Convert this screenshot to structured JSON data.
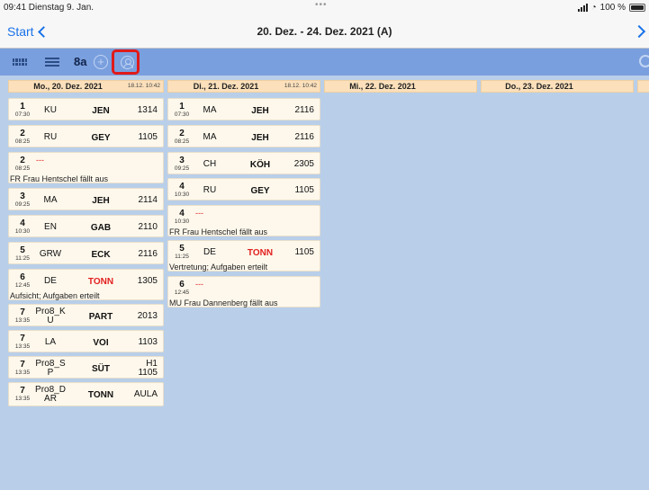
{
  "status": {
    "time_date": "09:41  Dienstag 9. Jan.",
    "dots": "•••",
    "battery": "100 %"
  },
  "nav": {
    "back_label": "Start",
    "title": "20. Dez. - 24. Dez. 2021 (A)"
  },
  "toolbar": {
    "class_label": "8a",
    "add": "+"
  },
  "days": [
    {
      "label": "Mo., 20. Dez. 2021",
      "timestamp": "18.12. 10:42"
    },
    {
      "label": "Di., 21. Dez. 2021",
      "timestamp": "18.12. 10:42"
    },
    {
      "label": "Mi., 22. Dez. 2021",
      "timestamp": ""
    },
    {
      "label": "Do., 23. Dez. 2021",
      "timestamp": ""
    }
  ],
  "monday": [
    {
      "period": "1",
      "time": "07:30",
      "subject": "KU",
      "teacher": "JEN",
      "room": "1314"
    },
    {
      "period": "2",
      "time": "08:25",
      "subject": "RU",
      "teacher": "GEY",
      "room": "1105"
    },
    {
      "period": "2",
      "time": "08:25",
      "dash": "---",
      "note": "FR Frau Hentschel fällt aus"
    },
    {
      "period": "3",
      "time": "09:25",
      "subject": "MA",
      "teacher": "JEH",
      "room": "2114"
    },
    {
      "period": "4",
      "time": "10:30",
      "subject": "EN",
      "teacher": "GAB",
      "room": "2110"
    },
    {
      "period": "5",
      "time": "11:25",
      "subject": "GRW",
      "teacher": "ECK",
      "room": "2116"
    },
    {
      "period": "6",
      "time": "12:45",
      "subject": "DE",
      "teacher": "TONN",
      "room": "1305",
      "note": "Aufsicht; Aufgaben erteilt"
    },
    {
      "period": "7",
      "time": "13:35",
      "subject_line1": "Pro8_K",
      "subject_line2": "U",
      "teacher": "PART",
      "room": "2013"
    },
    {
      "period": "7",
      "time": "13:35",
      "subject": "LA",
      "teacher": "VOI",
      "room": "1103"
    },
    {
      "period": "7",
      "time": "13:35",
      "subject_line1": "Pro8_S",
      "subject_line2": "P",
      "teacher": "SÜT",
      "room_line1": "H1",
      "room_line2": "1105"
    },
    {
      "period": "7",
      "time": "13:35",
      "subject_line1": "Pro8_D",
      "subject_line2": "AR",
      "teacher": "TONN",
      "room": "AULA"
    }
  ],
  "tuesday": [
    {
      "period": "1",
      "time": "07:30",
      "subject": "MA",
      "teacher": "JEH",
      "room": "2116"
    },
    {
      "period": "2",
      "time": "08:25",
      "subject": "MA",
      "teacher": "JEH",
      "room": "2116"
    },
    {
      "period": "3",
      "time": "09:25",
      "subject": "CH",
      "teacher": "KÖH",
      "room": "2305"
    },
    {
      "period": "4",
      "time": "10:30",
      "subject": "RU",
      "teacher": "GEY",
      "room": "1105"
    },
    {
      "period": "4",
      "time": "10:30",
      "dash": "---",
      "note": "FR Frau Hentschel fällt aus"
    },
    {
      "period": "5",
      "time": "11:25",
      "subject": "DE",
      "teacher": "TONN",
      "room": "1105",
      "note": "Vertretung; Aufgaben erteilt"
    },
    {
      "period": "6",
      "time": "12:45",
      "dash": "---",
      "note": "MU Frau Dannenberg fällt aus"
    }
  ],
  "colors": {
    "toolbar": "#7a9fde",
    "background": "#b9cfe9",
    "header": "#fbe0bb",
    "card": "#fef8ec",
    "accent": "#1a73e8",
    "highlight": "#e01a1a",
    "substitution": "#e21f1f"
  }
}
